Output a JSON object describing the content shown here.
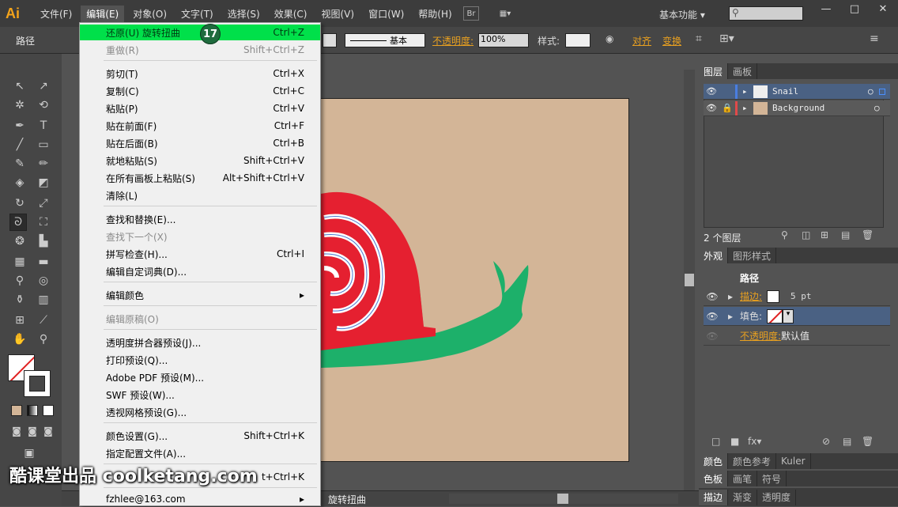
{
  "app": {
    "logo": "Ai"
  },
  "menubar": {
    "items": [
      "文件(F)",
      "编辑(E)",
      "对象(O)",
      "文字(T)",
      "选择(S)",
      "效果(C)",
      "视图(V)",
      "窗口(W)",
      "帮助(H)"
    ],
    "br_label": "Br",
    "workspace": "基本功能",
    "window_buttons": [
      "—",
      "□",
      "✕"
    ]
  },
  "control_bar": {
    "selection": "路径",
    "stroke_style": "基本",
    "opacity_label": "不透明度:",
    "opacity_value": "100%",
    "style_label": "样式:",
    "align_label": "对齐",
    "transform_label": "变换"
  },
  "edit_menu": {
    "step_badge": "17",
    "items": [
      {
        "label": "还原(U) 旋转扭曲",
        "shortcut": "Ctrl+Z",
        "state": "highlight"
      },
      {
        "label": "重做(R)",
        "shortcut": "Shift+Ctrl+Z",
        "state": "disabled"
      },
      {
        "label": "剪切(T)",
        "shortcut": "Ctrl+X"
      },
      {
        "label": "复制(C)",
        "shortcut": "Ctrl+C"
      },
      {
        "label": "粘贴(P)",
        "shortcut": "Ctrl+V"
      },
      {
        "label": "贴在前面(F)",
        "shortcut": "Ctrl+F"
      },
      {
        "label": "贴在后面(B)",
        "shortcut": "Ctrl+B"
      },
      {
        "label": "就地粘贴(S)",
        "shortcut": "Shift+Ctrl+V"
      },
      {
        "label": "在所有画板上粘贴(S)",
        "shortcut": "Alt+Shift+Ctrl+V"
      },
      {
        "label": "清除(L)",
        "shortcut": ""
      },
      {
        "label": "查找和替换(E)...",
        "shortcut": ""
      },
      {
        "label": "查找下一个(X)",
        "shortcut": "",
        "state": "disabled"
      },
      {
        "label": "拼写检查(H)...",
        "shortcut": "Ctrl+I"
      },
      {
        "label": "编辑自定词典(D)...",
        "shortcut": ""
      },
      {
        "label": "编辑颜色",
        "shortcut": "▸"
      },
      {
        "label": "编辑原稿(O)",
        "shortcut": "",
        "state": "disabled"
      },
      {
        "label": "透明度拼合器预设(J)...",
        "shortcut": ""
      },
      {
        "label": "打印预设(Q)...",
        "shortcut": ""
      },
      {
        "label": "Adobe PDF 预设(M)...",
        "shortcut": ""
      },
      {
        "label": "SWF 预设(W)...",
        "shortcut": ""
      },
      {
        "label": "透视网格预设(G)...",
        "shortcut": ""
      },
      {
        "label": "颜色设置(G)...",
        "shortcut": "Shift+Ctrl+K"
      },
      {
        "label": "指定配置文件(A)...",
        "shortcut": ""
      },
      {
        "label": "",
        "shortcut": "t+Ctrl+K"
      },
      {
        "label": "fzhlee@163.com",
        "shortcut": "▸"
      }
    ]
  },
  "layers_panel": {
    "tabs": [
      "图层",
      "画板"
    ],
    "layers": [
      "Snail",
      "Background"
    ],
    "count": "2 个图层"
  },
  "appearance_panel": {
    "tabs": [
      "外观",
      "图形样式"
    ],
    "title": "路径",
    "stroke_label": "描边:",
    "stroke_value": "5 pt",
    "fill_label": "填色:",
    "opacity_label": "不透明度:",
    "opacity_value": "默认值"
  },
  "bottom_tabs": {
    "row1": [
      "颜色",
      "颜色参考",
      "Kuler"
    ],
    "row2": [
      "色板",
      "画笔",
      "符号"
    ],
    "row3": [
      "描边",
      "渐变",
      "透明度"
    ]
  },
  "status": {
    "tool_name": "旋转扭曲"
  },
  "watermark": "酷课堂出品 coolketang.com",
  "colors": {
    "snail_shell": "#e52030",
    "snail_body": "#1db06a",
    "artboard": "#d3b597",
    "menu_highlight": "#00e04a"
  }
}
